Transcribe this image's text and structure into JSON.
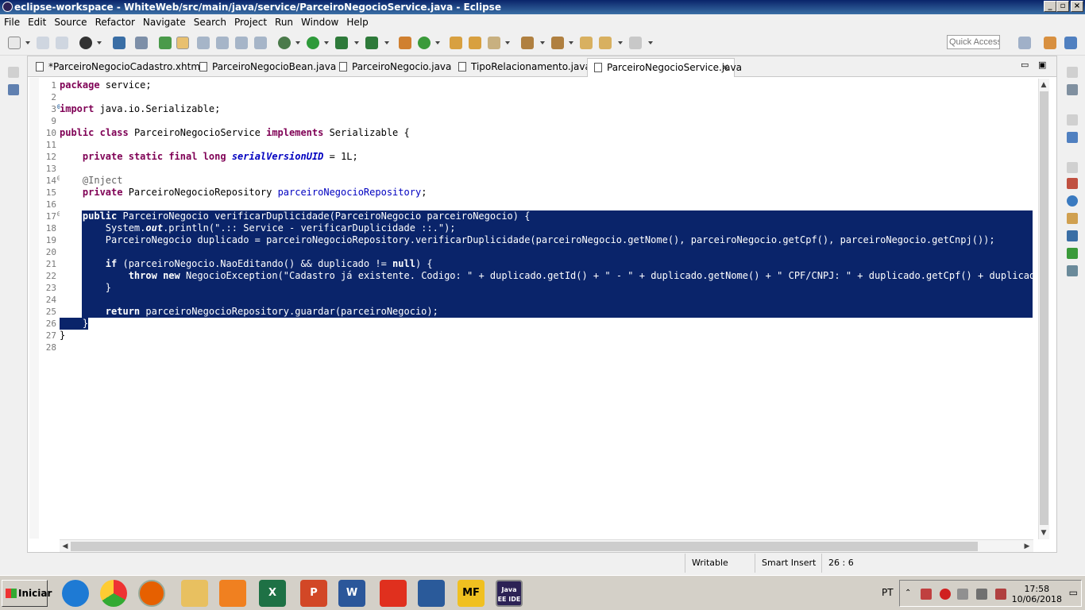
{
  "window": {
    "title": "eclipse-workspace - WhiteWeb/src/main/java/service/ParceiroNegocioService.java - Eclipse"
  },
  "menu": [
    "File",
    "Edit",
    "Source",
    "Refactor",
    "Navigate",
    "Search",
    "Project",
    "Run",
    "Window",
    "Help"
  ],
  "quick_access": {
    "placeholder": "Quick Access"
  },
  "tabs": [
    {
      "label": "*ParceiroNegocioCadastro.xhtml",
      "active": false
    },
    {
      "label": "ParceiroNegocioBean.java",
      "active": false
    },
    {
      "label": "ParceiroNegocio.java",
      "active": false
    },
    {
      "label": "TipoRelacionamento.java",
      "active": false
    },
    {
      "label": "ParceiroNegocioService.java",
      "active": true
    }
  ],
  "editor": {
    "line_numbers": [
      "1",
      "2",
      "3",
      "9",
      "10",
      "11",
      "12",
      "13",
      "14",
      "15",
      "16",
      "17",
      "18",
      "19",
      "20",
      "21",
      "22",
      "23",
      "24",
      "25",
      "26",
      "27",
      "28"
    ],
    "lines": [
      "package service;",
      "",
      "import java.io.Serializable;",
      "",
      "public class ParceiroNegocioService implements Serializable {",
      "",
      "    private static final long serialVersionUID = 1L;",
      "",
      "    @Inject",
      "    private ParceiroNegocioRepository parceiroNegocioRepository;",
      "",
      "    public ParceiroNegocio verificarDuplicidade(ParceiroNegocio parceiroNegocio) {",
      "        System.out.println(\".:: Service - verificarDuplicidade ::.\");",
      "        ParceiroNegocio duplicado = parceiroNegocioRepository.verificarDuplicidade(parceiroNegocio.getNome(), parceiroNegocio.getCpf(), parceiroNegocio.getCnpj());",
      "",
      "        if (parceiroNegocio.NaoEditando() && duplicado != null) {",
      "            throw new NegocioException(\"Cadastro já existente. Codigo: \" + duplicado.getId() + \" - \" + duplicado.getNome() + \" CPF/CNPJ: \" + duplicado.getCpf() + duplicado.get",
      "        }",
      "",
      "        return parceiroNegocioRepository.guardar(parceiroNegocio);",
      "    }",
      "}",
      ""
    ]
  },
  "status": {
    "writable": "Writable",
    "insert_mode": "Smart Insert",
    "position": "26 : 6"
  },
  "taskbar": {
    "start": "Iniciar",
    "lang": "PT",
    "time": "17:58",
    "date": "10/06/2018",
    "apps": [
      "internet-explorer",
      "chrome",
      "firefox",
      "file-explorer",
      "media-player",
      "excel",
      "powerpoint",
      "word",
      "acrobat",
      "virtualbox",
      "mf",
      "java-ee-ide"
    ],
    "mf_label": "MF",
    "jee_label": "Java EE IDE"
  }
}
